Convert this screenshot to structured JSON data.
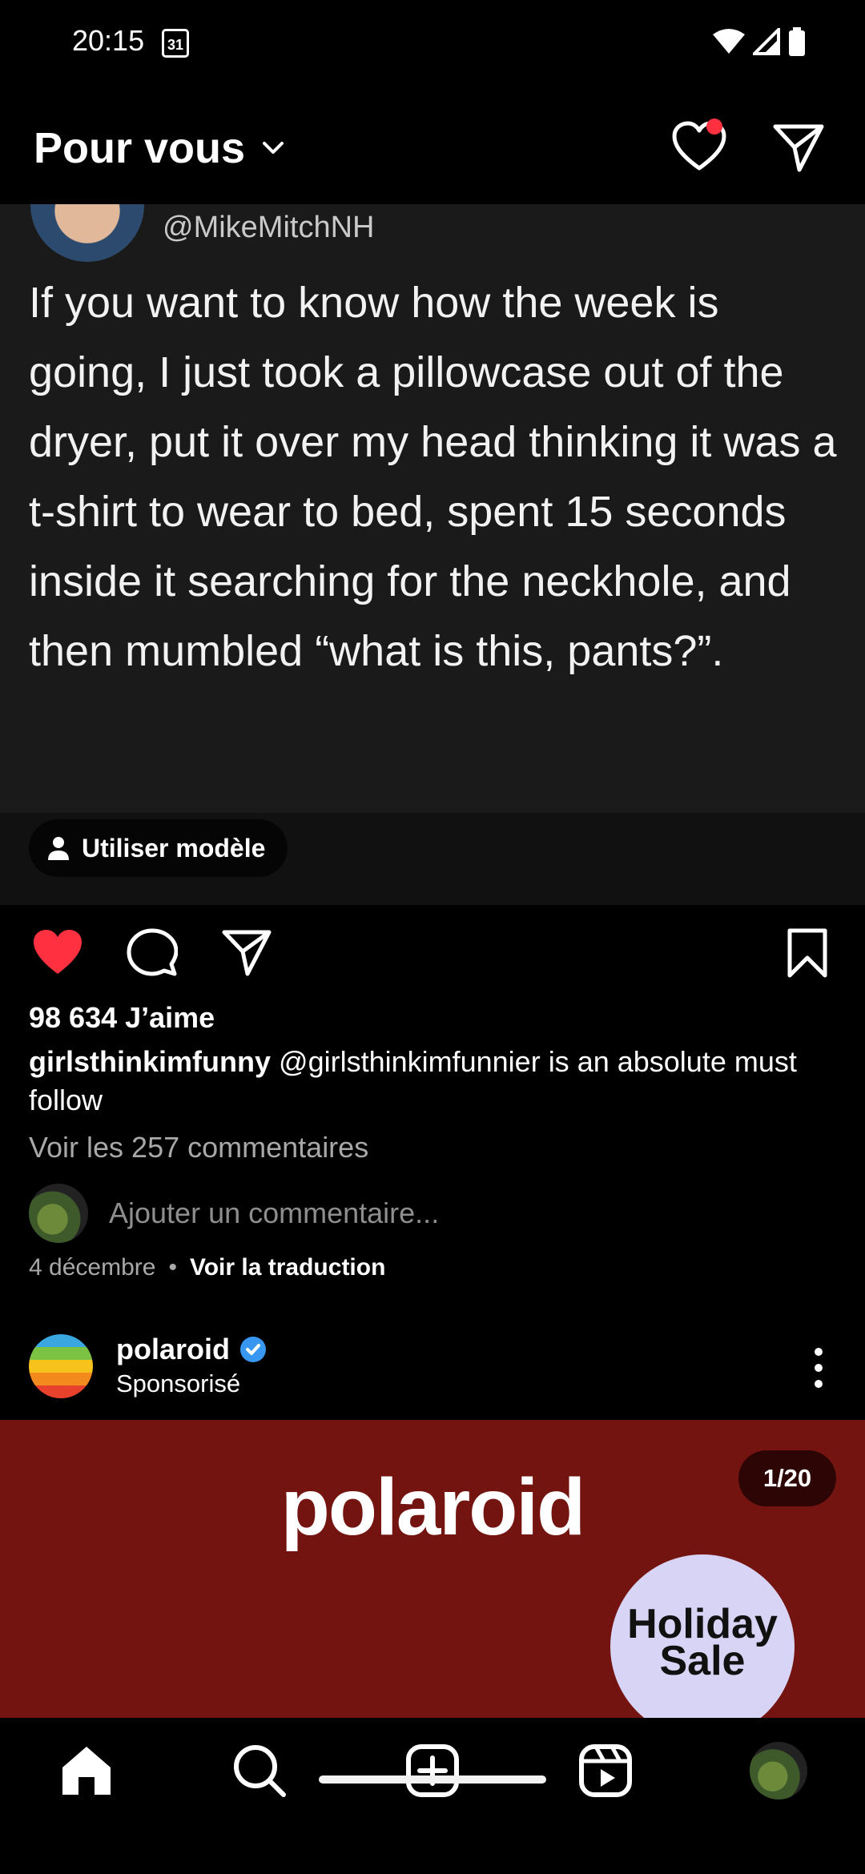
{
  "status_bar": {
    "time": "20:15",
    "calendar_day": "31"
  },
  "header": {
    "title": "Pour vous"
  },
  "post": {
    "tweet_handle": "@MikeMitchNH",
    "tweet_text": "If you want to know how the week is going, I just took a pillowcase out of the dryer, put it over my head thinking it was a t-shirt to wear to bed, spent 15 seconds inside it searching for the neckhole, and then mumbled “what is this, pants?”.",
    "template_label": "Utiliser modèle",
    "likes": "98 634 J’aime",
    "caption_user": "girlsthinkimfunny",
    "caption_text": "@girlsthinkimfunnier is an absolute must follow",
    "view_comments": "Voir les 257 commentaires",
    "comment_placeholder": "Ajouter un commentaire...",
    "date": "4 décembre",
    "separator": "•",
    "translate": "Voir la traduction"
  },
  "sponsored": {
    "name": "polaroid",
    "label": "Sponsorisé",
    "ad_brand": "polaroid",
    "counter": "1/20",
    "badge_line1": "Holiday",
    "badge_line2": "Sale"
  },
  "colors": {
    "like_red": "#ff3040",
    "ad_background": "#731410",
    "verified_blue": "#3897f0",
    "badge_lavender": "#d8d4f6"
  }
}
